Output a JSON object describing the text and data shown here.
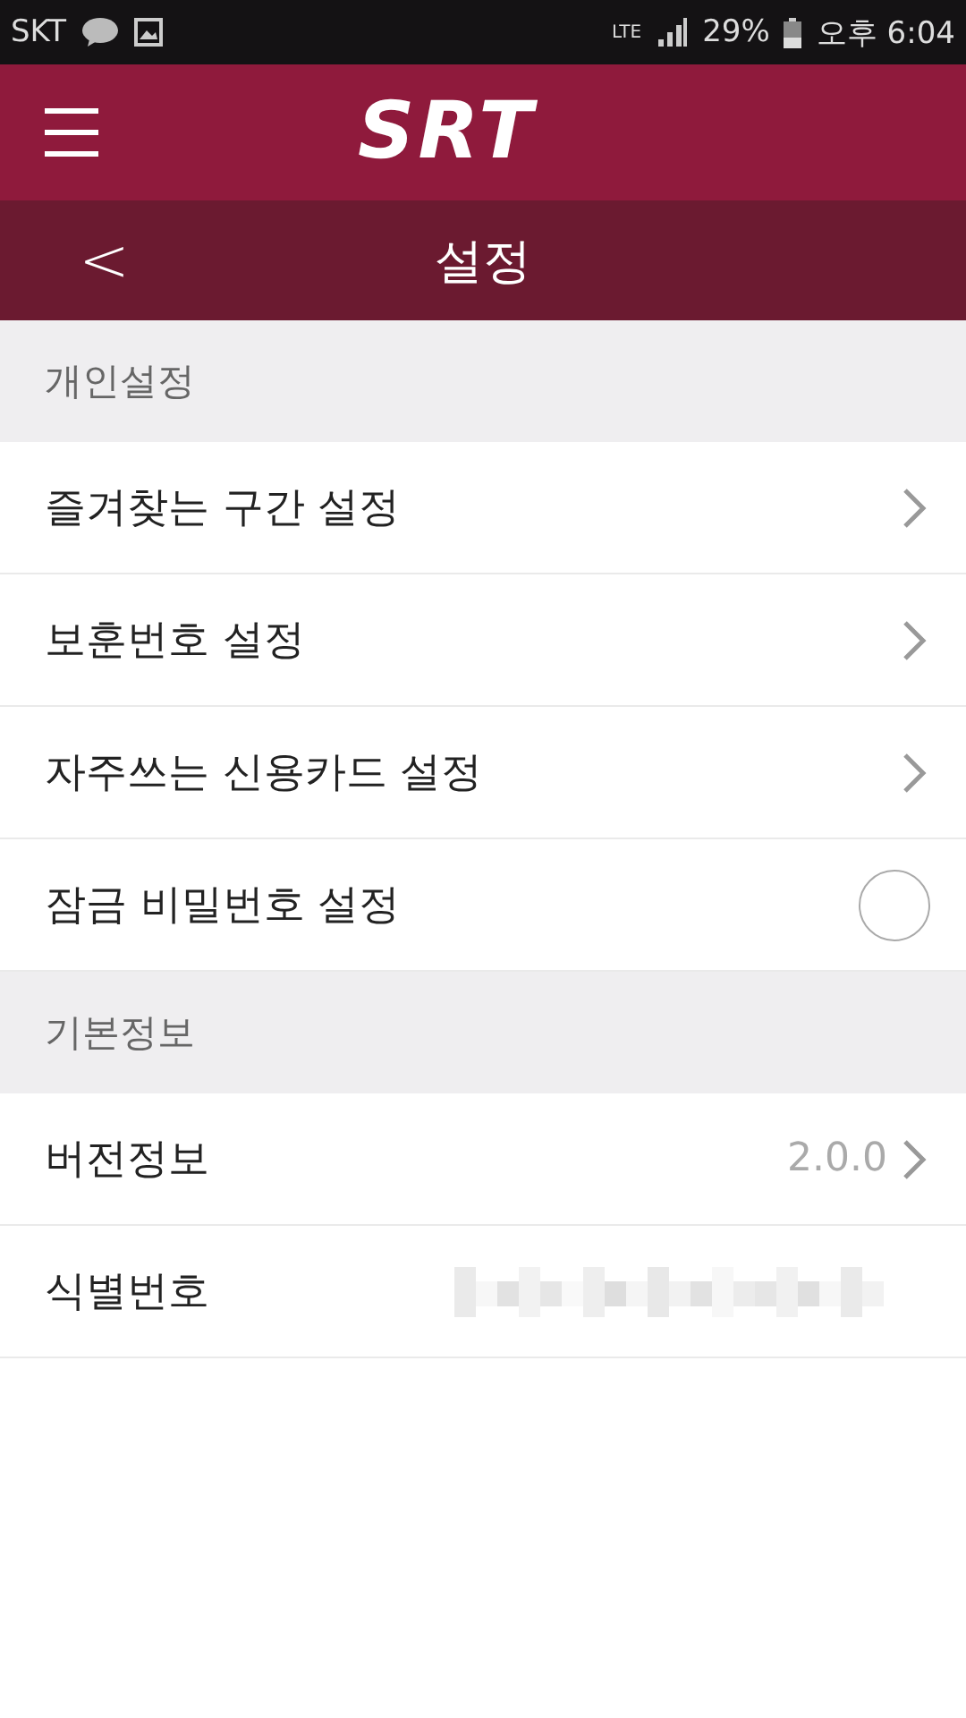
{
  "status_bar": {
    "carrier": "SKT",
    "network": "LTE",
    "battery": "29%",
    "time": "오후 6:04"
  },
  "app_bar": {
    "logo": "SRT"
  },
  "title_bar": {
    "back": "<",
    "title": "설정"
  },
  "sections": [
    {
      "title": "개인설정",
      "rows": [
        {
          "kind": "link",
          "label": "즐겨찾는 구간 설정"
        },
        {
          "kind": "link",
          "label": "보훈번호 설정"
        },
        {
          "kind": "link",
          "label": "자주쓰는 신용카드 설정"
        },
        {
          "kind": "toggle",
          "label": "잠금 비밀번호 설정",
          "on": false
        }
      ]
    },
    {
      "title": "기본정보",
      "rows": [
        {
          "kind": "value",
          "label": "버전정보",
          "value": "2.0.0"
        },
        {
          "kind": "redacted",
          "label": "식별번호"
        }
      ]
    }
  ]
}
